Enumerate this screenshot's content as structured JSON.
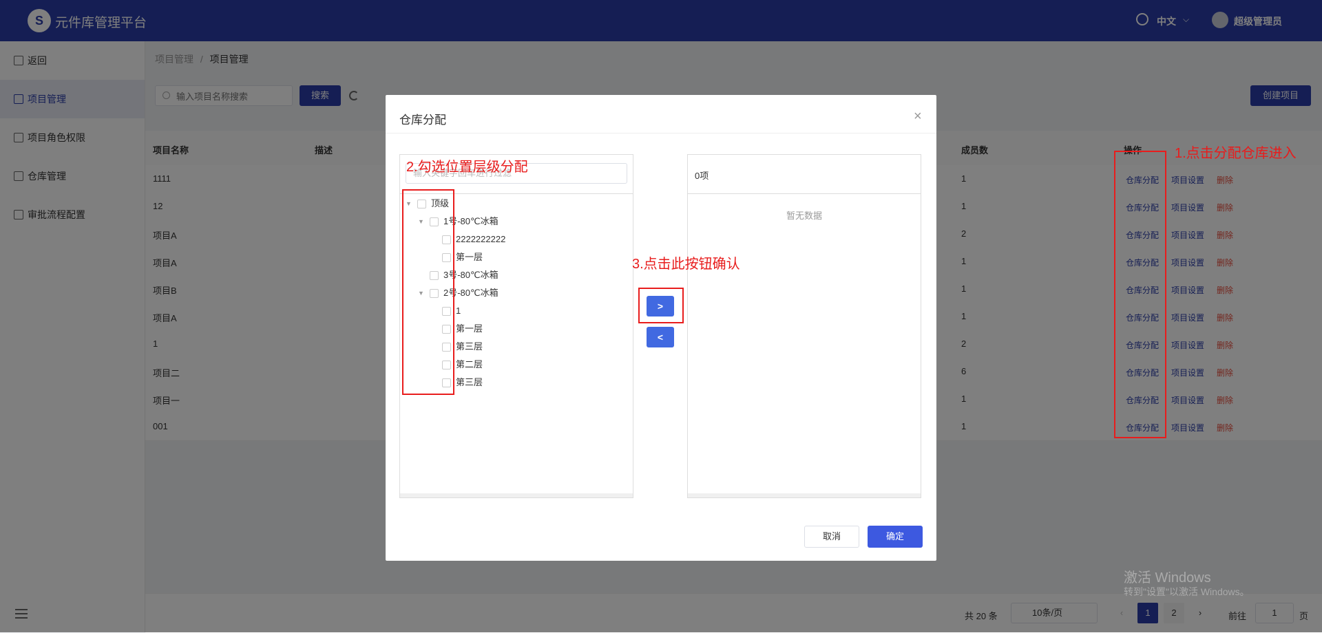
{
  "header": {
    "logo_letter": "S",
    "app_title": "元件库管理平台",
    "language": "中文",
    "user_name": "超级管理员"
  },
  "sidebar": {
    "items": [
      {
        "label": "返回"
      },
      {
        "label": "项目管理"
      },
      {
        "label": "项目角色权限"
      },
      {
        "label": "仓库管理"
      },
      {
        "label": "审批流程配置"
      }
    ]
  },
  "breadcrumb": {
    "parent": "项目管理",
    "sep": "/",
    "current": "项目管理"
  },
  "toolbar": {
    "search_placeholder": "输入项目名称搜索",
    "search_button": "搜索",
    "create_button": "创建项目"
  },
  "table": {
    "headers": {
      "name": "项目名称",
      "desc": "描述",
      "members": "成员数",
      "ops": "操作"
    },
    "op_labels": {
      "assign": "仓库分配",
      "settings": "项目设置",
      "delete": "删除"
    },
    "rows": [
      {
        "name": "1111",
        "members": "1"
      },
      {
        "name": "12",
        "members": "1"
      },
      {
        "name": "项目A",
        "members": "2"
      },
      {
        "name": "项目A",
        "members": "1"
      },
      {
        "name": "项目B",
        "members": "1"
      },
      {
        "name": "项目A",
        "members": "1"
      },
      {
        "name": "1",
        "members": "2"
      },
      {
        "name": "项目二",
        "members": "6"
      },
      {
        "name": "项目一",
        "members": "1"
      },
      {
        "name": "001",
        "members": "1"
      }
    ]
  },
  "pagination": {
    "total": "共 20 条",
    "page_size": "10条/页",
    "prev": "‹",
    "pages": [
      "1",
      "2"
    ],
    "next": "›",
    "goto_label": "前往",
    "goto_value": "1",
    "unit": "页"
  },
  "modal": {
    "title": "仓库分配",
    "close": "×",
    "filter_placeholder": "输入关键字回车进行过滤",
    "tree": [
      {
        "label": "顶级",
        "level": 0,
        "expanded": true
      },
      {
        "label": "1号-80℃冰箱",
        "level": 1,
        "expanded": true
      },
      {
        "label": "2222222222",
        "level": 2
      },
      {
        "label": "第一层",
        "level": 2
      },
      {
        "label": "3号-80℃冰箱",
        "level": 1
      },
      {
        "label": "2号-80℃冰箱",
        "level": 1,
        "expanded": true
      },
      {
        "label": "1",
        "level": 2
      },
      {
        "label": "第一层",
        "level": 2
      },
      {
        "label": "第三层",
        "level": 2
      },
      {
        "label": "第二层",
        "level": 2
      },
      {
        "label": "第三层",
        "level": 2
      }
    ],
    "right_count": "0项",
    "empty_text": "暂无数据",
    "btn_right": ">",
    "btn_left": "<",
    "cancel": "取消",
    "ok": "确定"
  },
  "annotations": {
    "step1": "1.点击分配仓库进入",
    "step2": "2.勾选位置层级分配",
    "step3": "3.点击此按钮确认"
  },
  "watermark": {
    "line1": "激活 Windows",
    "line2": "转到\"设置\"以激活 Windows。"
  },
  "colors": {
    "header": "#2b3da8",
    "primary": "#3d59e0",
    "annotation": "#e81c1c"
  }
}
